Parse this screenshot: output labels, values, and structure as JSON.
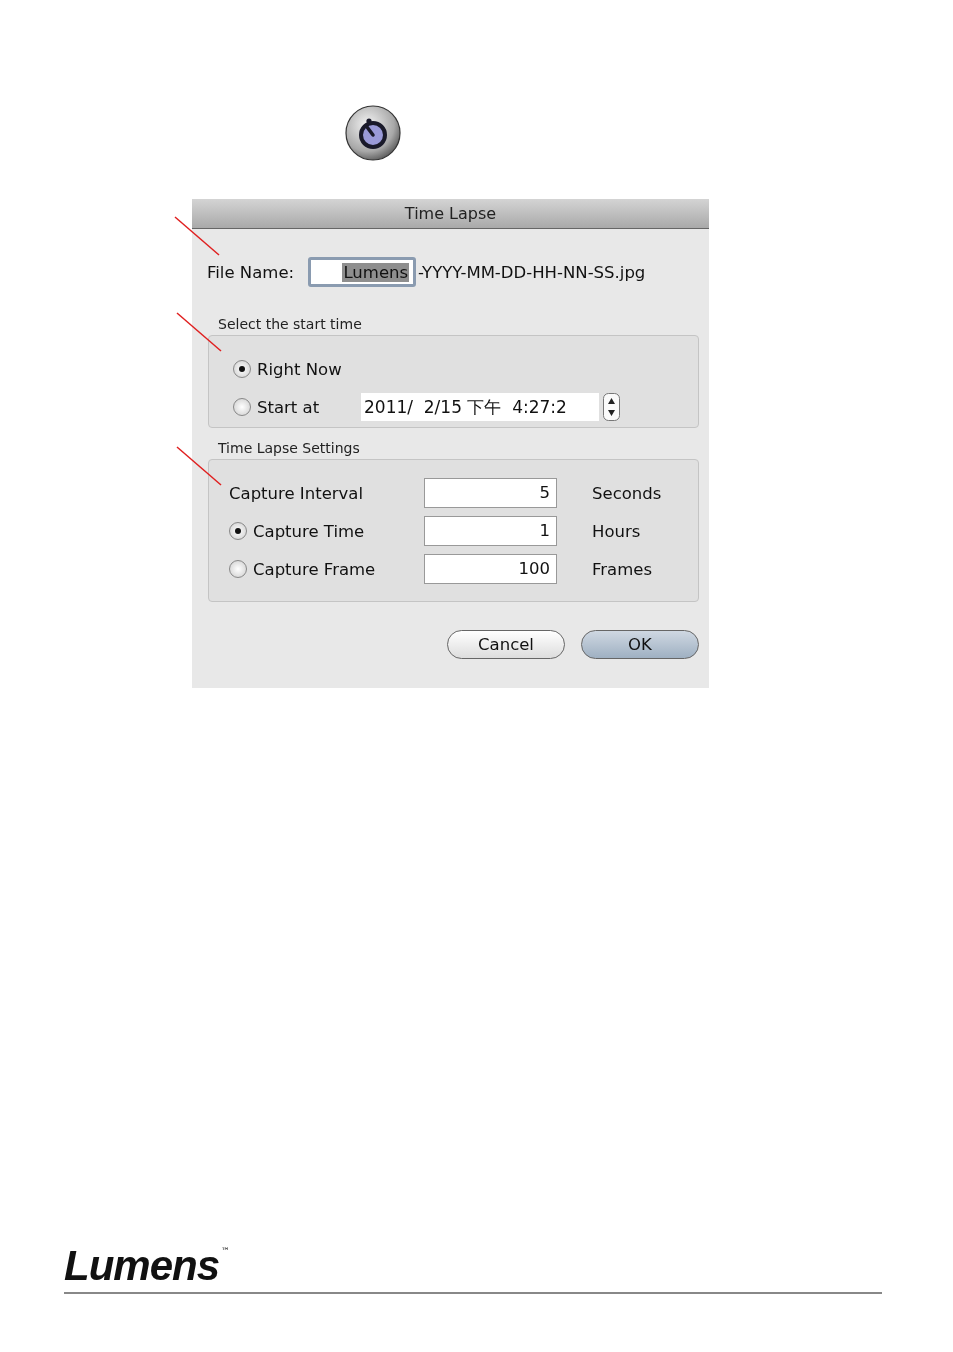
{
  "window": {
    "title": "Time Lapse"
  },
  "file_name": {
    "label": "File Name:",
    "value": "Lumens",
    "highlighted": true,
    "suffix": "-YYYY-MM-DD-HH-NN-SS.jpg"
  },
  "start_time": {
    "title": "Select the start time",
    "options": [
      {
        "label": "Right Now",
        "selected": true
      },
      {
        "label": "Start at",
        "selected": false
      }
    ],
    "datetime": "2011/  2/15 下午  4:27:2"
  },
  "settings": {
    "title": "Time Lapse Settings",
    "rows": [
      {
        "kind": "plain",
        "label": "Capture Interval",
        "value": "5",
        "unit": "Seconds"
      },
      {
        "kind": "radio",
        "label": "Capture Time",
        "selected": true,
        "value": "1",
        "unit": "Hours"
      },
      {
        "kind": "radio",
        "label": "Capture Frame",
        "selected": false,
        "value": "100",
        "unit": "Frames"
      }
    ]
  },
  "buttons": [
    {
      "label": "Cancel",
      "default": false
    },
    {
      "label": "OK",
      "default": true
    }
  ],
  "footer": {
    "logo": "Lumens",
    "trademark": "™"
  }
}
